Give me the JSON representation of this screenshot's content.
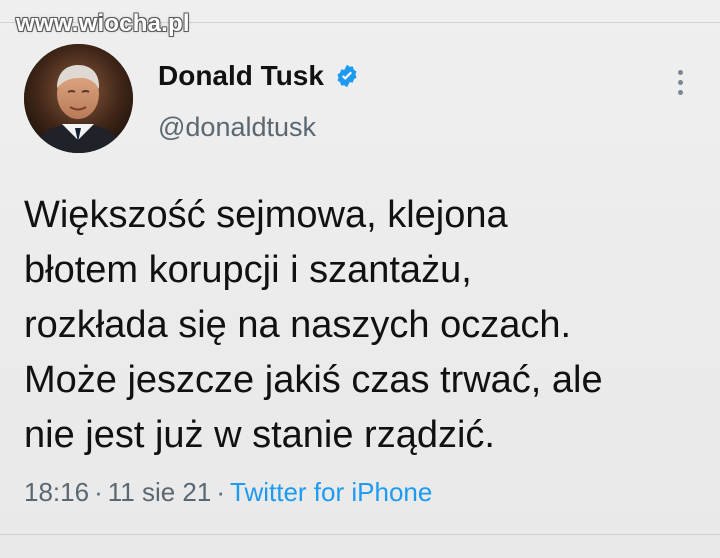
{
  "watermark": {
    "text": "www.wiocha.pl"
  },
  "tweet": {
    "author": {
      "display_name": "Donald Tusk",
      "handle": "@donaldtusk",
      "verified": true
    },
    "text_lines": [
      "Większość sejmowa, klejona",
      "błotem korupcji i szantażu,",
      "rozkłada się na naszych oczach.",
      "Może jeszcze jakiś czas trwać, ale",
      "nie jest już w stanie rządzić."
    ],
    "meta": {
      "time": "18:16",
      "separator": "·",
      "date": "11 sie 21",
      "source": "Twitter for iPhone"
    }
  },
  "colors": {
    "background": "#ececec",
    "text": "#111111",
    "secondary_text": "#5b6872",
    "accent": "#1d9bf0",
    "verified_badge": "#1d9bf0"
  },
  "icons": {
    "verified": "verified-badge-icon",
    "more": "more-vertical-icon"
  }
}
